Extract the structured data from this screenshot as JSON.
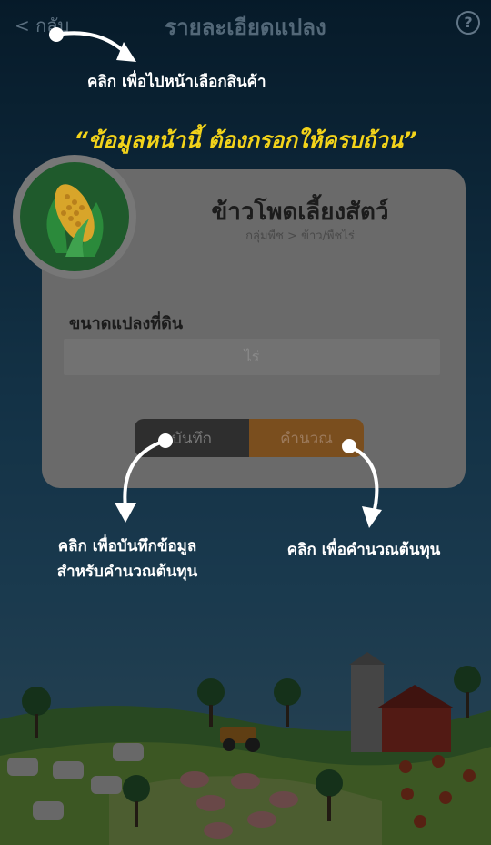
{
  "header": {
    "back_label": "< กลับ",
    "title": "รายละเอียดแปลง",
    "help_label": "?"
  },
  "product": {
    "name": "ข้าวโพดเลี้ยงสัตว์",
    "breadcrumb": "กลุ่มพืช > ข้าว/พืชไร่"
  },
  "form": {
    "field_label": "ขนาดแปลงที่ดิน",
    "unit_placeholder": "ไร่"
  },
  "buttons": {
    "save_label": "บันทึก",
    "calculate_label": "คำนวณ"
  },
  "hints": {
    "back_hint": "คลิก  เพื่อไปหน้าเลือกสินค้า",
    "banner": "“ข้อมูลหน้านี้  ต้องกรอกให้ครบถ้วน”",
    "save_hint_line1": "คลิก  เพื่อบันทึกข้อมูล",
    "save_hint_line2": "สำหรับคำนวณต้นทุน",
    "calc_hint": "คลิก  เพื่อคำนวณต้นทุน"
  },
  "colors": {
    "banner": "#f3d31a",
    "calculate_button": "#7a4e1e",
    "save_button": "#2e2e2e",
    "card": "#6a6a6a"
  }
}
